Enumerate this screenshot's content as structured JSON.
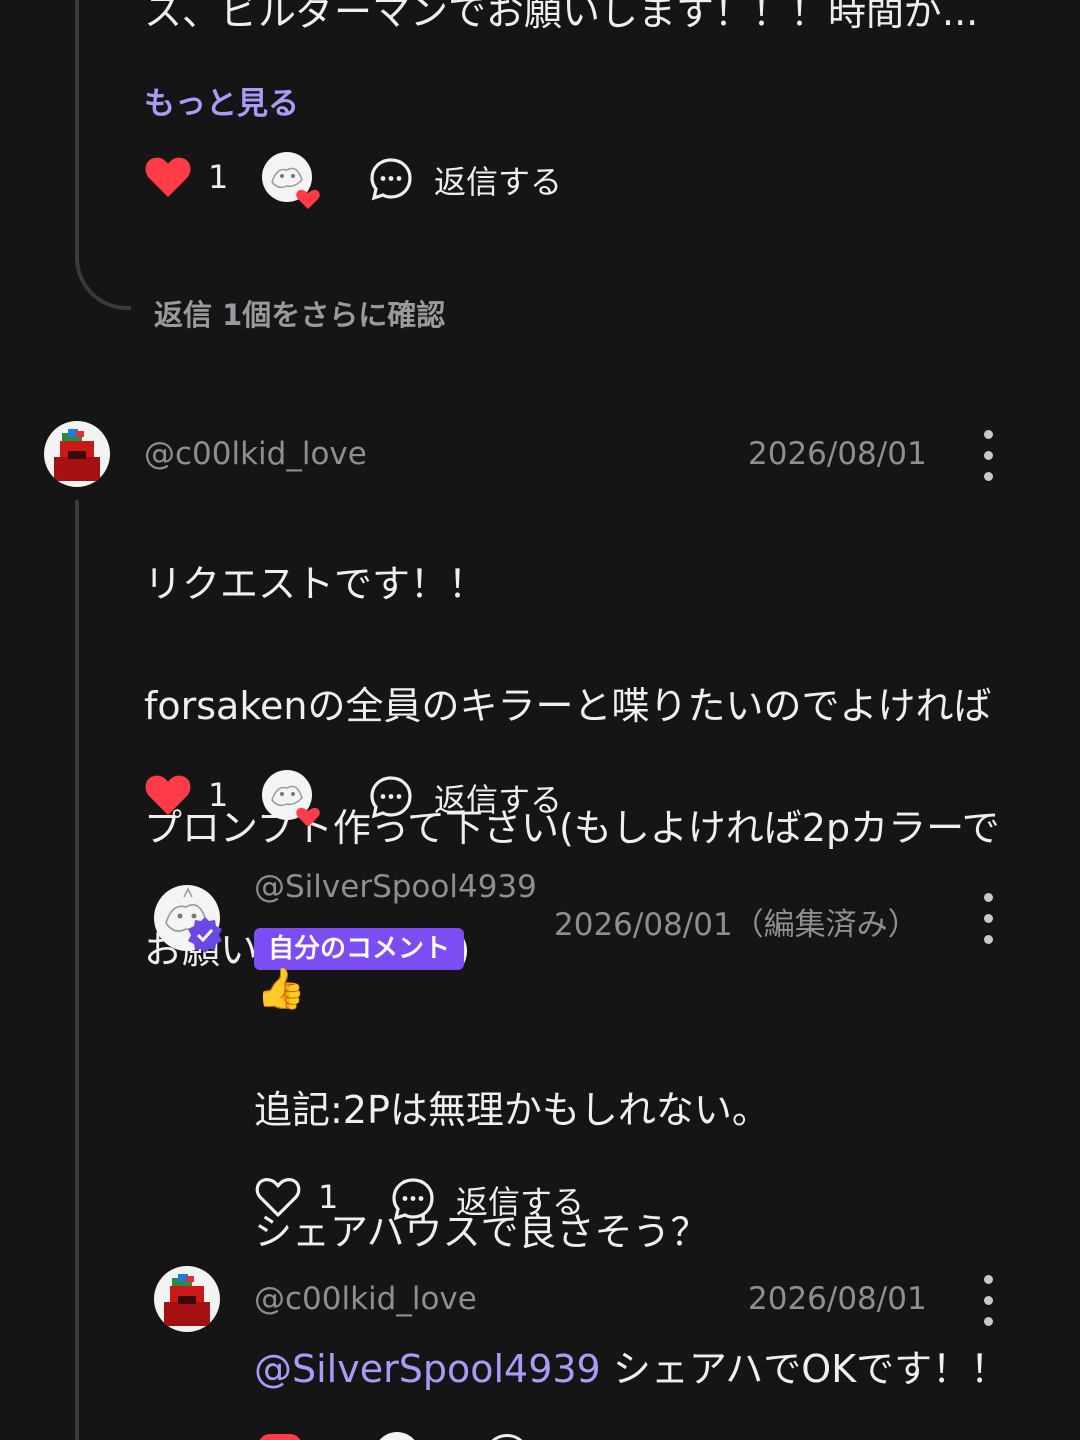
{
  "comment1": {
    "text_tail": "ス、ビルダーマンでお願いします！！！時間が...",
    "more_label": "もっと見る",
    "like_count": "1",
    "reply_label": "返信する"
  },
  "see_more_replies": "返信 1個をさらに確認",
  "comment2": {
    "username": "@c00lkid_love",
    "date": "2026/08/01",
    "lines": [
      "リクエストです！！",
      "forsakenの全員のキラーと喋りたいのでよければ",
      "プロンプト作って下さい(もしよければ2pカラーで",
      "お願いします...👀)"
    ],
    "like_count": "1",
    "reply_label": "返信する"
  },
  "reply1": {
    "username": "@SilverSpool4939",
    "date": "2026/08/01",
    "edited": "（編集済み）",
    "badge": "自分のコメント",
    "emoji": "👍",
    "lines": [
      "追記:2Pは無理かもしれない。",
      "シェアハウスで良さそう？"
    ],
    "like_count": "1",
    "reply_label": "返信する"
  },
  "reply2": {
    "username": "@c00lkid_love",
    "date": "2026/08/01",
    "mention": "@SilverSpool4939",
    "text": " シェアハでOKです！！"
  },
  "colors": {
    "background": "#151516",
    "accent": "#a89cf7",
    "heart": "#ff3b47",
    "badge": "#7b4df2"
  }
}
